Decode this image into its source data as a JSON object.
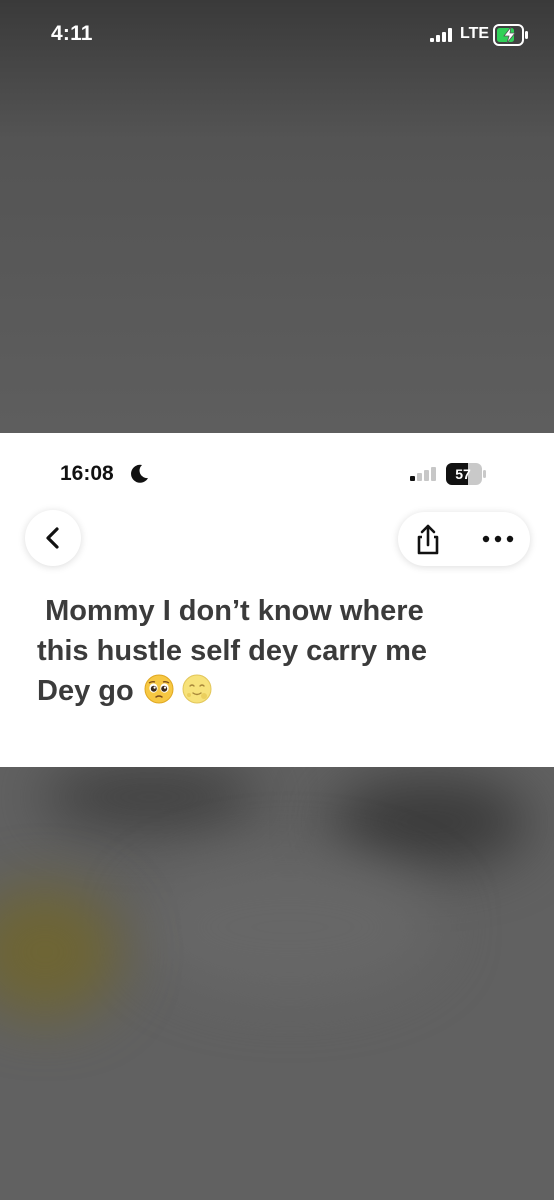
{
  "outer_status_bar": {
    "time": "4:11",
    "network": "LTE",
    "battery_state": "charging"
  },
  "inner_status_bar": {
    "time": "16:08",
    "battery_level": "57",
    "focus_mode_icon": "moon-icon"
  },
  "toolbar": {
    "back_icon": "chevron-left-icon",
    "share_icon": "share-icon",
    "more_icon": "ellipsis-icon"
  },
  "post": {
    "line1": " Mommy I don’t know where",
    "line2": "this hustle self dey carry me",
    "line3": "Dey go",
    "emojis": [
      "pleading-face-emoji",
      "full-moon-face-emoji"
    ]
  },
  "colors": {
    "card_background": "#ffffff",
    "dim_background": "#5f5f5f",
    "battery_green": "#30d158",
    "text": "#3b3b3b"
  }
}
